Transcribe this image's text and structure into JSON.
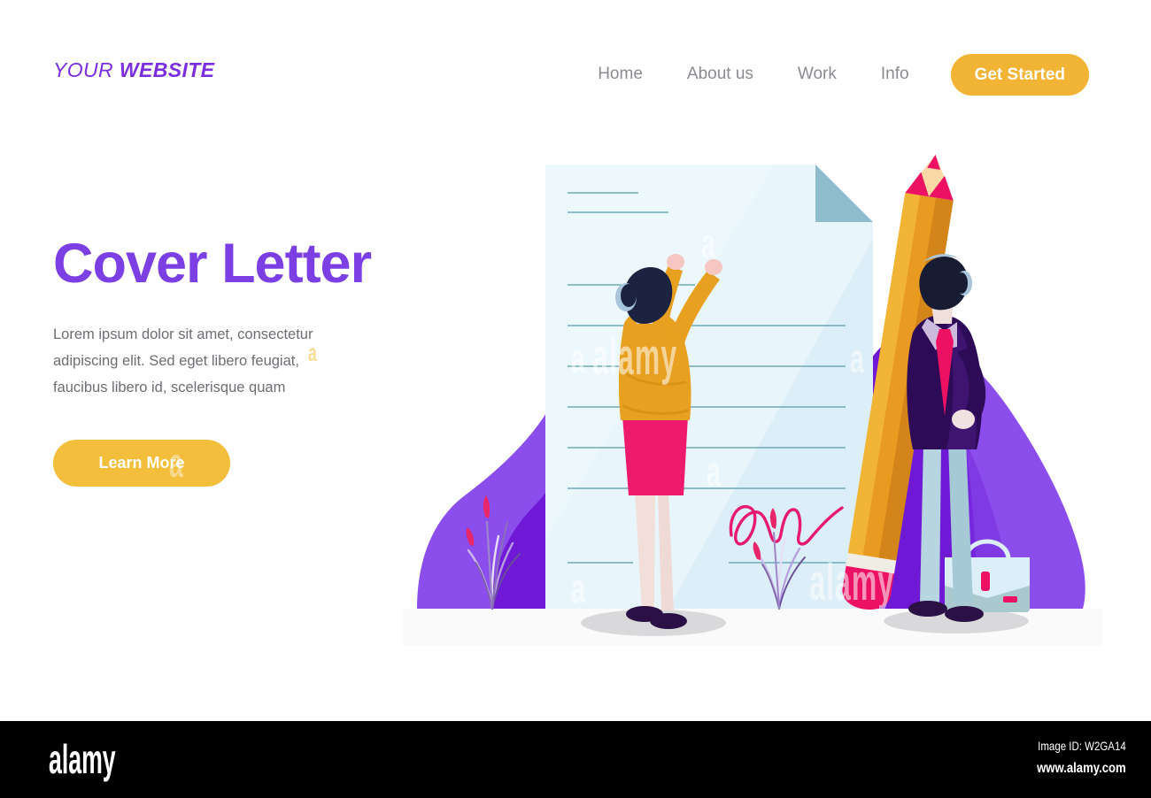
{
  "header": {
    "logo_light": "YOUR ",
    "logo_bold": "WEBSITE",
    "nav": [
      {
        "label": "Home"
      },
      {
        "label": "About us"
      },
      {
        "label": "Work"
      },
      {
        "label": "Info"
      }
    ],
    "cta_label": "Get Started"
  },
  "hero": {
    "title": "Cover Letter",
    "paragraph": "Lorem ipsum dolor sit amet, consectetur adipiscing elit. Sed eget libero feugiat, faucibus libero id, scelerisque quam",
    "button_label": "Learn More"
  },
  "illustration": {
    "alt": "Two people signing a large cover letter document with a giant pencil",
    "document_label": "cover-letter-document",
    "signature_label": "handwritten-signature"
  },
  "watermarks": {
    "letter": "a",
    "word": "alamy"
  },
  "footer": {
    "brand": "alamy",
    "image_id": "Image ID: W2GA14",
    "url": "www.alamy.com"
  },
  "colors": {
    "purple": "#7B3FE4",
    "purple_dark": "#6F19D6",
    "purple_light": "#8B4DEB",
    "yellow": "#F2B434",
    "orange": "#E89A21",
    "pink": "#ED1164",
    "paper": "#E1F0F7",
    "paper_light": "#EAF5FB",
    "line": "#6FA9B8",
    "fold": "#8FBCCC",
    "gray_text": "#8b8b92",
    "body_text": "#6d6d73",
    "black": "#000000"
  }
}
